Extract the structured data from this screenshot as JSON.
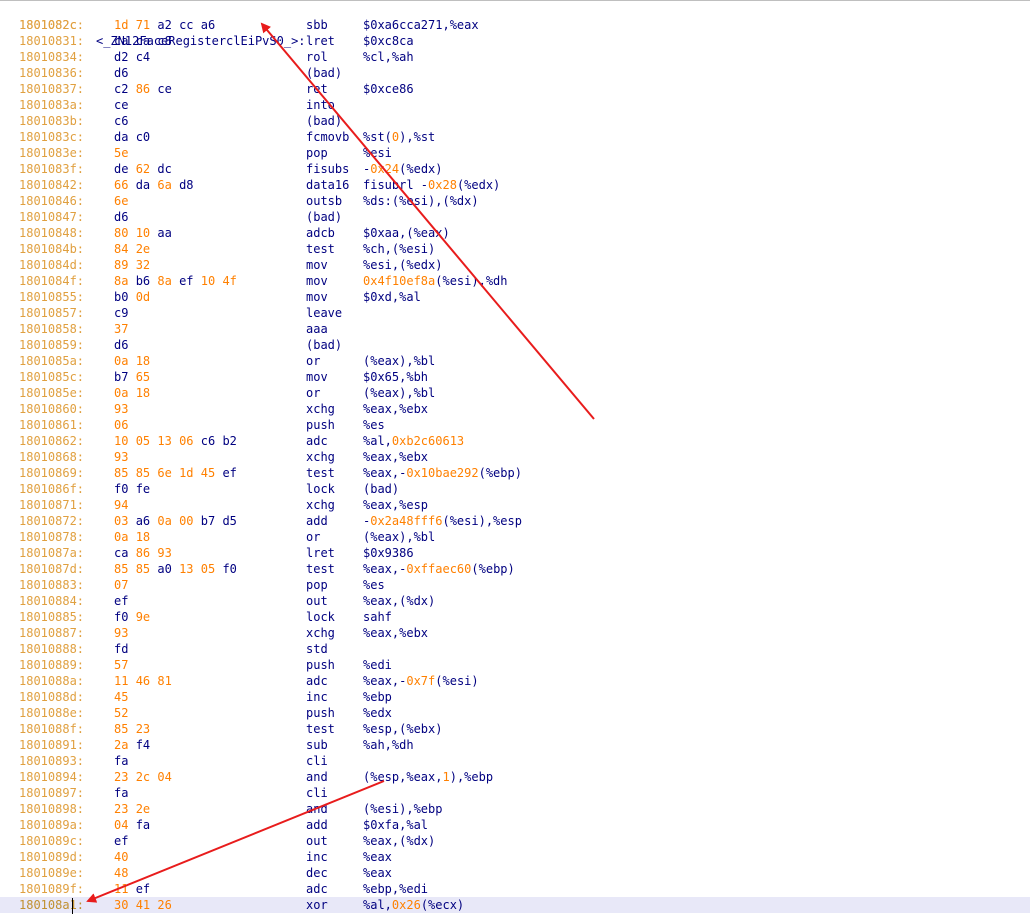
{
  "label_line": {
    "address": "1801082c",
    "label": "<_ZN12FaceRegisterclEiPvS0_>:"
  },
  "lines": [
    {
      "address": "1801082c:",
      "bytes": [
        [
          "1d",
          "n"
        ],
        [
          "71",
          "n"
        ],
        [
          "a2",
          "a"
        ],
        [
          "cc",
          "a"
        ],
        [
          "a6",
          "a"
        ]
      ],
      "mnemonic": "sbb",
      "operands": [
        [
          "$0xa6cca271,%eax",
          "p"
        ]
      ]
    },
    {
      "address": "18010831:",
      "bytes": [
        [
          "ca",
          "a"
        ],
        [
          "ca",
          "a"
        ],
        [
          "c8",
          "a"
        ]
      ],
      "mnemonic": "lret",
      "operands": [
        [
          "$0xc8ca",
          "p"
        ]
      ]
    },
    {
      "address": "18010834:",
      "bytes": [
        [
          "d2",
          "a"
        ],
        [
          "c4",
          "a"
        ]
      ],
      "mnemonic": "rol",
      "operands": [
        [
          "%cl,%ah",
          "p"
        ]
      ]
    },
    {
      "address": "18010836:",
      "bytes": [
        [
          "d6",
          "a"
        ]
      ],
      "mnemonic": "(bad)",
      "operands": []
    },
    {
      "address": "18010837:",
      "bytes": [
        [
          "c2",
          "a"
        ],
        [
          "86",
          "n"
        ],
        [
          "ce",
          "a"
        ]
      ],
      "mnemonic": "ret",
      "operands": [
        [
          "$0xce86",
          "p"
        ]
      ]
    },
    {
      "address": "1801083a:",
      "bytes": [
        [
          "ce",
          "a"
        ]
      ],
      "mnemonic": "into",
      "operands": []
    },
    {
      "address": "1801083b:",
      "bytes": [
        [
          "c6",
          "a"
        ]
      ],
      "mnemonic": "(bad)",
      "operands": []
    },
    {
      "address": "1801083c:",
      "bytes": [
        [
          "da",
          "a"
        ],
        [
          "c0",
          "a"
        ]
      ],
      "mnemonic": "fcmovb",
      "operands": [
        [
          "%st(",
          "p"
        ],
        [
          "0",
          "n"
        ],
        [
          "),%st",
          "p"
        ]
      ]
    },
    {
      "address": "1801083e:",
      "bytes": [
        [
          "5e",
          "n"
        ]
      ],
      "mnemonic": "pop",
      "operands": [
        [
          "%esi",
          "p"
        ]
      ]
    },
    {
      "address": "1801083f:",
      "bytes": [
        [
          "de",
          "a"
        ],
        [
          "62",
          "n"
        ],
        [
          "dc",
          "a"
        ]
      ],
      "mnemonic": "fisubs",
      "operands": [
        [
          "-",
          "p"
        ],
        [
          "0x24",
          "n"
        ],
        [
          "(%edx)",
          "p"
        ]
      ]
    },
    {
      "address": "18010842:",
      "bytes": [
        [
          "66",
          "n"
        ],
        [
          "da",
          "a"
        ],
        [
          "6a",
          "n"
        ],
        [
          "d8",
          "a"
        ]
      ],
      "mnemonic": "data16",
      "operands": [
        [
          "fisubrl -",
          "p"
        ],
        [
          "0x28",
          "n"
        ],
        [
          "(%edx)",
          "p"
        ]
      ]
    },
    {
      "address": "18010846:",
      "bytes": [
        [
          "6e",
          "n"
        ]
      ],
      "mnemonic": "outsb",
      "operands": [
        [
          "%ds:(%esi),(%dx)",
          "p"
        ]
      ]
    },
    {
      "address": "18010847:",
      "bytes": [
        [
          "d6",
          "a"
        ]
      ],
      "mnemonic": "(bad)",
      "operands": []
    },
    {
      "address": "18010848:",
      "bytes": [
        [
          "80",
          "n"
        ],
        [
          "10",
          "n"
        ],
        [
          "aa",
          "a"
        ]
      ],
      "mnemonic": "adcb",
      "operands": [
        [
          "$0xaa,(%eax)",
          "p"
        ]
      ]
    },
    {
      "address": "1801084b:",
      "bytes": [
        [
          "84",
          "n"
        ],
        [
          "2e",
          "n"
        ]
      ],
      "mnemonic": "test",
      "operands": [
        [
          "%ch,(%esi)",
          "p"
        ]
      ]
    },
    {
      "address": "1801084d:",
      "bytes": [
        [
          "89",
          "n"
        ],
        [
          "32",
          "n"
        ]
      ],
      "mnemonic": "mov",
      "operands": [
        [
          "%esi,(%edx)",
          "p"
        ]
      ]
    },
    {
      "address": "1801084f:",
      "bytes": [
        [
          "8a",
          "n"
        ],
        [
          "b6",
          "a"
        ],
        [
          "8a",
          "n"
        ],
        [
          "ef",
          "a"
        ],
        [
          "10",
          "n"
        ],
        [
          "4f",
          "n"
        ]
      ],
      "mnemonic": "mov",
      "operands": [
        [
          "0x4f10ef8a",
          "n"
        ],
        [
          "(%esi),%dh",
          "p"
        ]
      ]
    },
    {
      "address": "18010855:",
      "bytes": [
        [
          "b0",
          "a"
        ],
        [
          "0d",
          "n"
        ]
      ],
      "mnemonic": "mov",
      "operands": [
        [
          "$0xd,%al",
          "p"
        ]
      ]
    },
    {
      "address": "18010857:",
      "bytes": [
        [
          "c9",
          "a"
        ]
      ],
      "mnemonic": "leave",
      "operands": []
    },
    {
      "address": "18010858:",
      "bytes": [
        [
          "37",
          "n"
        ]
      ],
      "mnemonic": "aaa",
      "operands": []
    },
    {
      "address": "18010859:",
      "bytes": [
        [
          "d6",
          "a"
        ]
      ],
      "mnemonic": "(bad)",
      "operands": []
    },
    {
      "address": "1801085a:",
      "bytes": [
        [
          "0a",
          "n"
        ],
        [
          "18",
          "n"
        ]
      ],
      "mnemonic": "or",
      "operands": [
        [
          "(%eax),%bl",
          "p"
        ]
      ]
    },
    {
      "address": "1801085c:",
      "bytes": [
        [
          "b7",
          "a"
        ],
        [
          "65",
          "n"
        ]
      ],
      "mnemonic": "mov",
      "operands": [
        [
          "$0x65,%bh",
          "p"
        ]
      ]
    },
    {
      "address": "1801085e:",
      "bytes": [
        [
          "0a",
          "n"
        ],
        [
          "18",
          "n"
        ]
      ],
      "mnemonic": "or",
      "operands": [
        [
          "(%eax),%bl",
          "p"
        ]
      ]
    },
    {
      "address": "18010860:",
      "bytes": [
        [
          "93",
          "n"
        ]
      ],
      "mnemonic": "xchg",
      "operands": [
        [
          "%eax,%ebx",
          "p"
        ]
      ]
    },
    {
      "address": "18010861:",
      "bytes": [
        [
          "06",
          "n"
        ]
      ],
      "mnemonic": "push",
      "operands": [
        [
          "%es",
          "p"
        ]
      ]
    },
    {
      "address": "18010862:",
      "bytes": [
        [
          "10",
          "n"
        ],
        [
          "05",
          "n"
        ],
        [
          "13",
          "n"
        ],
        [
          "06",
          "n"
        ],
        [
          "c6",
          "a"
        ],
        [
          "b2",
          "a"
        ]
      ],
      "mnemonic": "adc",
      "operands": [
        [
          "%al,",
          "p"
        ],
        [
          "0xb2c60613",
          "n"
        ]
      ]
    },
    {
      "address": "18010868:",
      "bytes": [
        [
          "93",
          "n"
        ]
      ],
      "mnemonic": "xchg",
      "operands": [
        [
          "%eax,%ebx",
          "p"
        ]
      ]
    },
    {
      "address": "18010869:",
      "bytes": [
        [
          "85",
          "n"
        ],
        [
          "85",
          "n"
        ],
        [
          "6e",
          "n"
        ],
        [
          "1d",
          "n"
        ],
        [
          "45",
          "n"
        ],
        [
          "ef",
          "a"
        ]
      ],
      "mnemonic": "test",
      "operands": [
        [
          "%eax,-",
          "p"
        ],
        [
          "0x10bae292",
          "n"
        ],
        [
          "(%ebp)",
          "p"
        ]
      ]
    },
    {
      "address": "1801086f:",
      "bytes": [
        [
          "f0",
          "a"
        ],
        [
          "fe",
          "a"
        ]
      ],
      "mnemonic": "lock",
      "operands": [
        [
          "(bad)",
          "p"
        ]
      ]
    },
    {
      "address": "18010871:",
      "bytes": [
        [
          "94",
          "n"
        ]
      ],
      "mnemonic": "xchg",
      "operands": [
        [
          "%eax,%esp",
          "p"
        ]
      ]
    },
    {
      "address": "18010872:",
      "bytes": [
        [
          "03",
          "n"
        ],
        [
          "a6",
          "a"
        ],
        [
          "0a",
          "n"
        ],
        [
          "00",
          "n"
        ],
        [
          "b7",
          "a"
        ],
        [
          "d5",
          "a"
        ]
      ],
      "mnemonic": "add",
      "operands": [
        [
          "-",
          "p"
        ],
        [
          "0x2a48fff6",
          "n"
        ],
        [
          "(%esi),%esp",
          "p"
        ]
      ]
    },
    {
      "address": "18010878:",
      "bytes": [
        [
          "0a",
          "n"
        ],
        [
          "18",
          "n"
        ]
      ],
      "mnemonic": "or",
      "operands": [
        [
          "(%eax),%bl",
          "p"
        ]
      ]
    },
    {
      "address": "1801087a:",
      "bytes": [
        [
          "ca",
          "a"
        ],
        [
          "86",
          "n"
        ],
        [
          "93",
          "n"
        ]
      ],
      "mnemonic": "lret",
      "operands": [
        [
          "$0x9386",
          "p"
        ]
      ]
    },
    {
      "address": "1801087d:",
      "bytes": [
        [
          "85",
          "n"
        ],
        [
          "85",
          "n"
        ],
        [
          "a0",
          "a"
        ],
        [
          "13",
          "n"
        ],
        [
          "05",
          "n"
        ],
        [
          "f0",
          "a"
        ]
      ],
      "mnemonic": "test",
      "operands": [
        [
          "%eax,-",
          "p"
        ],
        [
          "0xffaec60",
          "n"
        ],
        [
          "(%ebp)",
          "p"
        ]
      ]
    },
    {
      "address": "18010883:",
      "bytes": [
        [
          "07",
          "n"
        ]
      ],
      "mnemonic": "pop",
      "operands": [
        [
          "%es",
          "p"
        ]
      ]
    },
    {
      "address": "18010884:",
      "bytes": [
        [
          "ef",
          "a"
        ]
      ],
      "mnemonic": "out",
      "operands": [
        [
          "%eax,(%dx)",
          "p"
        ]
      ]
    },
    {
      "address": "18010885:",
      "bytes": [
        [
          "f0",
          "a"
        ],
        [
          "9e",
          "n"
        ]
      ],
      "mnemonic": "lock",
      "operands": [
        [
          "sahf",
          "p"
        ]
      ]
    },
    {
      "address": "18010887:",
      "bytes": [
        [
          "93",
          "n"
        ]
      ],
      "mnemonic": "xchg",
      "operands": [
        [
          "%eax,%ebx",
          "p"
        ]
      ]
    },
    {
      "address": "18010888:",
      "bytes": [
        [
          "fd",
          "a"
        ]
      ],
      "mnemonic": "std",
      "operands": []
    },
    {
      "address": "18010889:",
      "bytes": [
        [
          "57",
          "n"
        ]
      ],
      "mnemonic": "push",
      "operands": [
        [
          "%edi",
          "p"
        ]
      ]
    },
    {
      "address": "1801088a:",
      "bytes": [
        [
          "11",
          "n"
        ],
        [
          "46",
          "n"
        ],
        [
          "81",
          "n"
        ]
      ],
      "mnemonic": "adc",
      "operands": [
        [
          "%eax,-",
          "p"
        ],
        [
          "0x7f",
          "n"
        ],
        [
          "(%esi)",
          "p"
        ]
      ]
    },
    {
      "address": "1801088d:",
      "bytes": [
        [
          "45",
          "n"
        ]
      ],
      "mnemonic": "inc",
      "operands": [
        [
          "%ebp",
          "p"
        ]
      ]
    },
    {
      "address": "1801088e:",
      "bytes": [
        [
          "52",
          "n"
        ]
      ],
      "mnemonic": "push",
      "operands": [
        [
          "%edx",
          "p"
        ]
      ]
    },
    {
      "address": "1801088f:",
      "bytes": [
        [
          "85",
          "n"
        ],
        [
          "23",
          "n"
        ]
      ],
      "mnemonic": "test",
      "operands": [
        [
          "%esp,(%ebx)",
          "p"
        ]
      ]
    },
    {
      "address": "18010891:",
      "bytes": [
        [
          "2a",
          "n"
        ],
        [
          "f4",
          "a"
        ]
      ],
      "mnemonic": "sub",
      "operands": [
        [
          "%ah,%dh",
          "p"
        ]
      ]
    },
    {
      "address": "18010893:",
      "bytes": [
        [
          "fa",
          "a"
        ]
      ],
      "mnemonic": "cli",
      "operands": []
    },
    {
      "address": "18010894:",
      "bytes": [
        [
          "23",
          "n"
        ],
        [
          "2c",
          "n"
        ],
        [
          "04",
          "n"
        ]
      ],
      "mnemonic": "and",
      "operands": [
        [
          "(%esp,%eax,",
          "p"
        ],
        [
          "1",
          "n"
        ],
        [
          "),%ebp",
          "p"
        ]
      ]
    },
    {
      "address": "18010897:",
      "bytes": [
        [
          "fa",
          "a"
        ]
      ],
      "mnemonic": "cli",
      "operands": []
    },
    {
      "address": "18010898:",
      "bytes": [
        [
          "23",
          "n"
        ],
        [
          "2e",
          "n"
        ]
      ],
      "mnemonic": "and",
      "operands": [
        [
          "(%esi),%ebp",
          "p"
        ]
      ]
    },
    {
      "address": "1801089a:",
      "bytes": [
        [
          "04",
          "n"
        ],
        [
          "fa",
          "a"
        ]
      ],
      "mnemonic": "add",
      "operands": [
        [
          "$0xfa,%al",
          "p"
        ]
      ]
    },
    {
      "address": "1801089c:",
      "bytes": [
        [
          "ef",
          "a"
        ]
      ],
      "mnemonic": "out",
      "operands": [
        [
          "%eax,(%dx)",
          "p"
        ]
      ]
    },
    {
      "address": "1801089d:",
      "bytes": [
        [
          "40",
          "n"
        ]
      ],
      "mnemonic": "inc",
      "operands": [
        [
          "%eax",
          "p"
        ]
      ]
    },
    {
      "address": "1801089e:",
      "bytes": [
        [
          "48",
          "n"
        ]
      ],
      "mnemonic": "dec",
      "operands": [
        [
          "%eax",
          "p"
        ]
      ]
    },
    {
      "address": "1801089f:",
      "bytes": [
        [
          "11",
          "n"
        ],
        [
          "ef",
          "a"
        ]
      ],
      "mnemonic": "adc",
      "operands": [
        [
          "%ebp,%edi",
          "p"
        ]
      ]
    },
    {
      "address": "180108a1:",
      "bytes": [
        [
          "30",
          "n"
        ],
        [
          "41",
          "n"
        ],
        [
          "26",
          "n"
        ]
      ],
      "mnemonic": "xor",
      "operands": [
        [
          "%al,",
          "p"
        ],
        [
          "0x26",
          "n"
        ],
        [
          "(%ecx)",
          "p"
        ]
      ],
      "current": true
    }
  ],
  "colors": {
    "address": "#e0a040",
    "number": "#ff8000",
    "text": "#000080",
    "current_line": "#e8e8f8",
    "arrow": "#e81c1c"
  },
  "annotations": [
    {
      "type": "arrow",
      "from": "right-middle",
      "to": "label-line",
      "color": "#e81c1c"
    },
    {
      "type": "arrow",
      "from": "and-line-operands",
      "to": "current-line-address",
      "color": "#e81c1c"
    }
  ]
}
